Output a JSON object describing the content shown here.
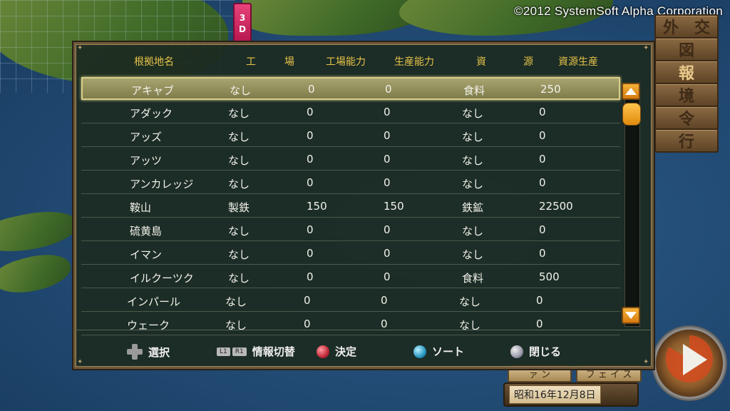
{
  "copyright": "©2012 SystemSoft Alpha Corporation",
  "toggle_3d": [
    "3",
    "D"
  ],
  "side_menu": [
    "外　交",
    "図",
    "報",
    "境",
    "令",
    "行"
  ],
  "side_menu_active": 2,
  "sub_buttons": [
    "ァ ン",
    "フ ェ イ ス"
  ],
  "date": "昭和16年12月8日",
  "table": {
    "headers": [
      "根拠地名",
      "工",
      "場",
      "工場能力",
      "生産能力",
      "資",
      "源",
      "資源生産"
    ],
    "rows": [
      {
        "name": "アキャブ",
        "factory": "なし",
        "factory_cap": "0",
        "production": "0",
        "resource": "食料",
        "resource_prod": "250"
      },
      {
        "name": "アダック",
        "factory": "なし",
        "factory_cap": "0",
        "production": "0",
        "resource": "なし",
        "resource_prod": "0"
      },
      {
        "name": "アッズ",
        "factory": "なし",
        "factory_cap": "0",
        "production": "0",
        "resource": "なし",
        "resource_prod": "0"
      },
      {
        "name": "アッツ",
        "factory": "なし",
        "factory_cap": "0",
        "production": "0",
        "resource": "なし",
        "resource_prod": "0"
      },
      {
        "name": "アンカレッジ",
        "factory": "なし",
        "factory_cap": "0",
        "production": "0",
        "resource": "なし",
        "resource_prod": "0"
      },
      {
        "name": "鞍山",
        "factory": "製鉄",
        "factory_cap": "150",
        "production": "150",
        "resource": "鉄鉱",
        "resource_prod": "22500"
      },
      {
        "name": "硫黄島",
        "factory": "なし",
        "factory_cap": "0",
        "production": "0",
        "resource": "なし",
        "resource_prod": "0"
      },
      {
        "name": "イマン",
        "factory": "なし",
        "factory_cap": "0",
        "production": "0",
        "resource": "なし",
        "resource_prod": "0"
      },
      {
        "name": "イルクーツク",
        "factory": "なし",
        "factory_cap": "0",
        "production": "0",
        "resource": "食料",
        "resource_prod": "500"
      },
      {
        "name": "インパール",
        "factory": "なし",
        "factory_cap": "0",
        "production": "0",
        "resource": "なし",
        "resource_prod": "0"
      },
      {
        "name": "ウェーク",
        "factory": "なし",
        "factory_cap": "0",
        "production": "0",
        "resource": "なし",
        "resource_prod": "0"
      }
    ],
    "selected_index": 0
  },
  "footer": {
    "select": "選択",
    "l1": "L1",
    "r1": "R1",
    "info_switch": "情報切替",
    "confirm": "決定",
    "sort": "ソート",
    "close": "閉じる"
  },
  "colors": {
    "header_text": "#e7c34a",
    "scroll_accent": "#f7b23a",
    "panel_border": "#6e5a3c"
  }
}
